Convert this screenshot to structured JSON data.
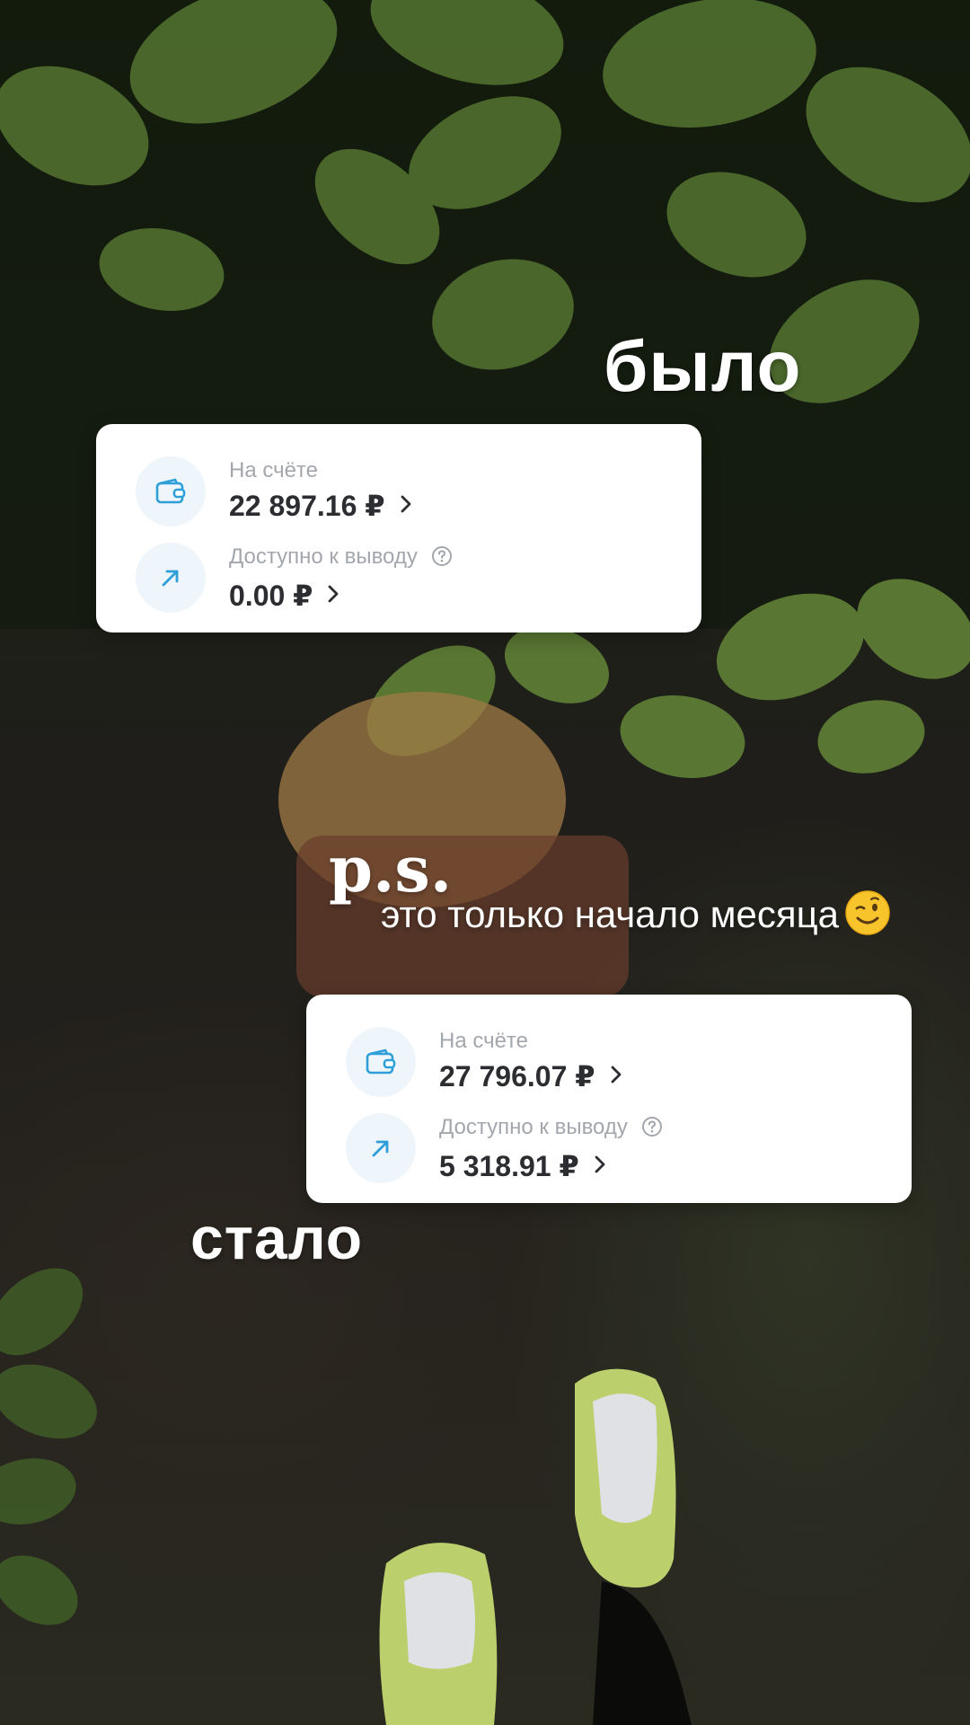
{
  "captions": {
    "before": "было",
    "after": "стало",
    "ps": "p.s.",
    "note": "это только начало месяца",
    "note_emoji": "winking-face-emoji"
  },
  "cards": {
    "before": {
      "balance_label": "На счёте",
      "balance_value": "22 897.16 ₽",
      "available_label": "Доступно к выводу",
      "available_value": "0.00 ₽"
    },
    "after": {
      "balance_label": "На счёте",
      "balance_value": "27 796.07 ₽",
      "available_label": "Доступно к выводу",
      "available_value": "5 318.91 ₽"
    }
  },
  "icons": {
    "balance": "wallet-icon",
    "available": "arrow-up-right-icon",
    "help": "question-circle-icon",
    "chevron": "chevron-right-icon"
  },
  "colors": {
    "icon_accent": "#2e9fd8",
    "icon_bg": "#eef6fb",
    "label": "#a3a7ad",
    "amount": "#2b2d31",
    "caption": "#ffffff"
  }
}
